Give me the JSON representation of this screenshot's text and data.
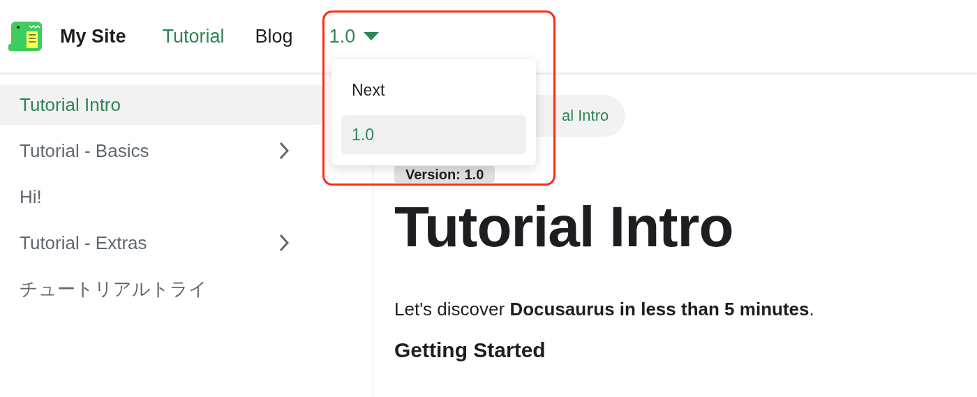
{
  "navbar": {
    "title": "My Site",
    "links": [
      {
        "label": "Tutorial",
        "selected": true
      },
      {
        "label": "Blog",
        "selected": false
      }
    ],
    "version_dropdown": {
      "label": "1.0",
      "expanded": true,
      "items": [
        {
          "label": "Next",
          "selected": false
        },
        {
          "label": "1.0",
          "selected": true
        }
      ]
    }
  },
  "sidebar": {
    "items": [
      {
        "label": "Tutorial Intro",
        "selected": true,
        "kind": "link"
      },
      {
        "label": "Tutorial - Basics",
        "selected": false,
        "kind": "category"
      },
      {
        "label": "Hi!",
        "selected": false,
        "kind": "link"
      },
      {
        "label": "Tutorial - Extras",
        "selected": false,
        "kind": "category"
      },
      {
        "label": "チュートリアルトライ",
        "selected": false,
        "kind": "link"
      }
    ]
  },
  "breadcrumb": {
    "current": "al Intro"
  },
  "version_badge": "Version: 1.0",
  "content": {
    "title": "Tutorial Intro",
    "intro": "Let's discover **Docusaurus in less than 5 minutes**.",
    "heading": "Getting Started"
  }
}
